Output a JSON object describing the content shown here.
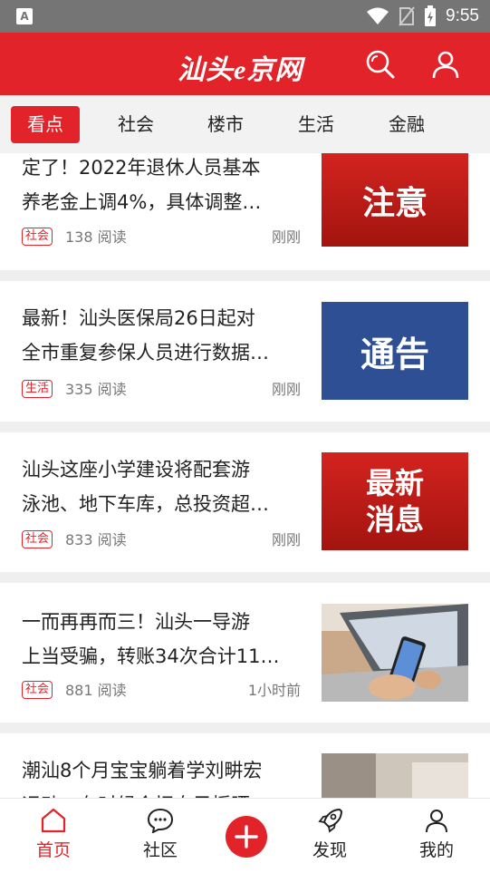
{
  "status_bar": {
    "time": "9:55",
    "left_icon": "A"
  },
  "header": {
    "logo": "汕头e京网",
    "icons": [
      "search-icon",
      "user-icon"
    ],
    "brand_color": "#e2232a"
  },
  "tabs": [
    {
      "label": "看点",
      "active": true
    },
    {
      "label": "社会",
      "active": false
    },
    {
      "label": "楼市",
      "active": false
    },
    {
      "label": "生活",
      "active": false
    },
    {
      "label": "金融",
      "active": false
    }
  ],
  "articles": [
    {
      "title_line1": "定了！2022年退休人员基本",
      "title_line2": "养老金上调4%，具体调整…",
      "tag": "社会",
      "reads": "138 阅读",
      "time": "刚刚",
      "thumb_text": "注意"
    },
    {
      "title_line1": "最新！汕头医保局26日起对",
      "title_line2": "全市重复参保人员进行数据…",
      "tag": "生活",
      "reads": "335 阅读",
      "time": "刚刚",
      "thumb_text": "通告"
    },
    {
      "title_line1": "汕头这座小学建设将配套游",
      "title_line2": "泳池、地下车库，总投资超…",
      "tag": "社会",
      "reads": "833 阅读",
      "time": "刚刚",
      "thumb_text_line1": "最新",
      "thumb_text_line2": "消息"
    },
    {
      "title_line1": "一而再再而三！汕头一导游",
      "title_line2": "上当受骗，转账34次合计11…",
      "tag": "社会",
      "reads": "881 阅读",
      "time": "1小时前"
    },
    {
      "title_line1": "潮汕8个月宝宝躺着学刘畊宏",
      "title_line2": "运动，有时候会把自己摇晒"
    }
  ],
  "bottom_nav": [
    {
      "label": "首页",
      "icon": "home-icon",
      "active": true
    },
    {
      "label": "社区",
      "icon": "chat-icon",
      "active": false
    },
    {
      "label": "",
      "icon": "plus-icon",
      "active": false
    },
    {
      "label": "发现",
      "icon": "rocket-icon",
      "active": false
    },
    {
      "label": "我的",
      "icon": "user-icon",
      "active": false
    }
  ]
}
